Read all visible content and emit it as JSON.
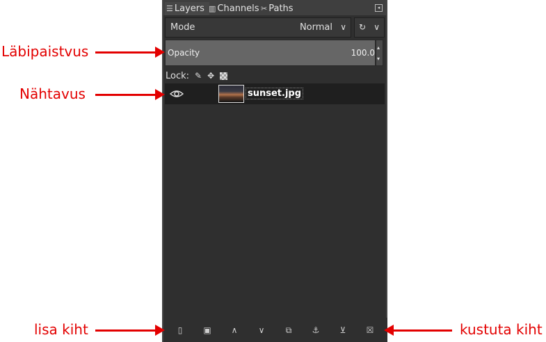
{
  "tabs": [
    {
      "label": "Layers",
      "icon": "layers-icon"
    },
    {
      "label": "Channels",
      "icon": "channels-icon"
    },
    {
      "label": "Paths",
      "icon": "paths-icon"
    }
  ],
  "mode": {
    "label": "Mode",
    "value": "Normal"
  },
  "opacity": {
    "label": "Opacity",
    "value": "100.0"
  },
  "lock": {
    "label": "Lock:"
  },
  "layer": {
    "name": "sunset.jpg"
  },
  "annotations": {
    "opacity_label": "Läbipaistvus",
    "visibility_label": "Nähtavus",
    "add_layer_label": "lisa kiht",
    "delete_layer_label": "kustuta kiht"
  },
  "colors": {
    "annotation": "#e30000",
    "panel": "#2f2f2f"
  }
}
